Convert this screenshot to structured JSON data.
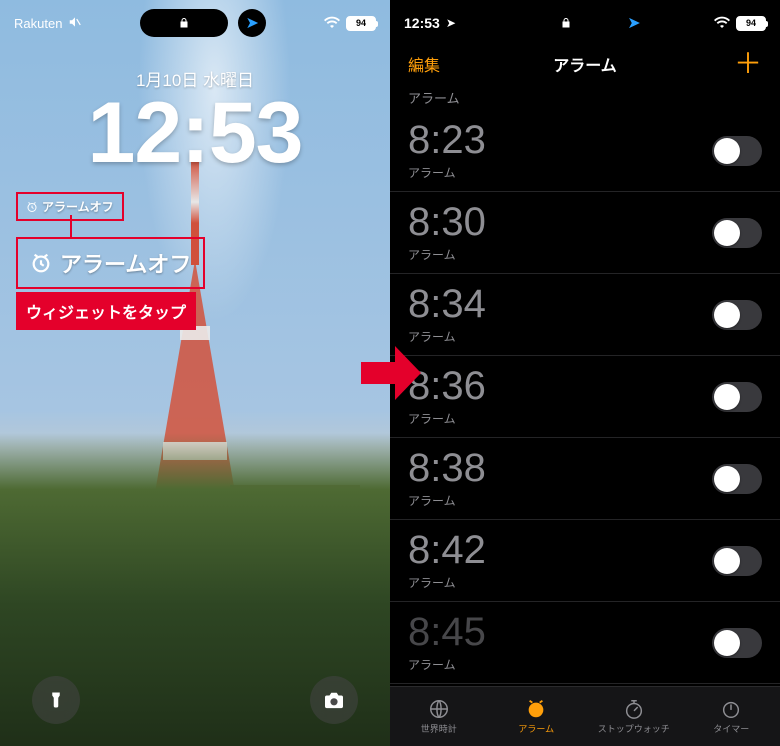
{
  "left": {
    "status": {
      "carrier": "Rakuten",
      "battery_pct": "94"
    },
    "date": "1月10日 水曜日",
    "time": "12:53",
    "widget_small": "アラームオフ",
    "widget_big": "アラームオフ",
    "callout": "ウィジェットをタップ"
  },
  "right": {
    "status": {
      "time": "12:53",
      "battery_pct": "94"
    },
    "nav": {
      "edit": "編集",
      "title": "アラーム",
      "add": "＋"
    },
    "section_header": "アラーム",
    "alarms": [
      {
        "time": "8:23",
        "label": "アラーム",
        "on": false
      },
      {
        "time": "8:30",
        "label": "アラーム",
        "on": false
      },
      {
        "time": "8:34",
        "label": "アラーム",
        "on": false
      },
      {
        "time": "8:36",
        "label": "アラーム",
        "on": false
      },
      {
        "time": "8:38",
        "label": "アラーム",
        "on": false
      },
      {
        "time": "8:42",
        "label": "アラーム",
        "on": false
      },
      {
        "time": "8:45",
        "label": "アラーム",
        "on": false
      }
    ],
    "tabs": {
      "world": "世界時計",
      "alarm": "アラーム",
      "stopwatch": "ストップウォッチ",
      "timer": "タイマー"
    }
  }
}
